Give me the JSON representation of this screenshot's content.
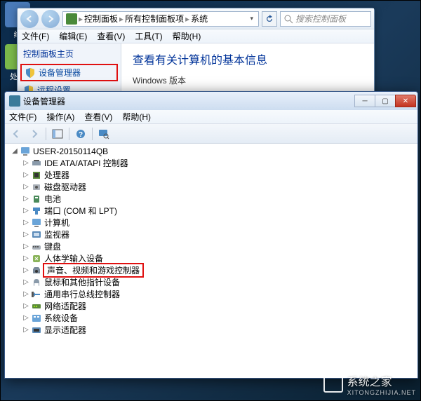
{
  "desktop": {
    "icon1_label": "络",
    "icon2_label": "处站"
  },
  "control_panel": {
    "breadcrumb": {
      "seg1": "控制面板",
      "seg2": "所有控制面板项",
      "seg3": "系统"
    },
    "search_placeholder": "搜索控制面板",
    "menus": {
      "file": "文件(F)",
      "edit": "编辑(E)",
      "view": "查看(V)",
      "tools": "工具(T)",
      "help": "帮助(H)"
    },
    "side": {
      "header": "控制面板主页",
      "link1": "设备管理器",
      "link2": "远程设置"
    },
    "main": {
      "heading": "查看有关计算机的基本信息",
      "section1": "Windows 版本"
    }
  },
  "device_manager": {
    "title": "设备管理器",
    "menus": {
      "file": "文件(F)",
      "action": "操作(A)",
      "view": "查看(V)",
      "help": "帮助(H)"
    },
    "root": "USER-20150114QB",
    "nodes": [
      "IDE ATA/ATAPI 控制器",
      "处理器",
      "磁盘驱动器",
      "电池",
      "端口 (COM 和 LPT)",
      "计算机",
      "监视器",
      "键盘",
      "人体学输入设备",
      "声音、视频和游戏控制器",
      "鼠标和其他指针设备",
      "通用串行总线控制器",
      "网络适配器",
      "系统设备",
      "显示适配器"
    ]
  },
  "watermark": {
    "text": "系统之家",
    "sub": "XITONGZHIJIA.NET"
  }
}
